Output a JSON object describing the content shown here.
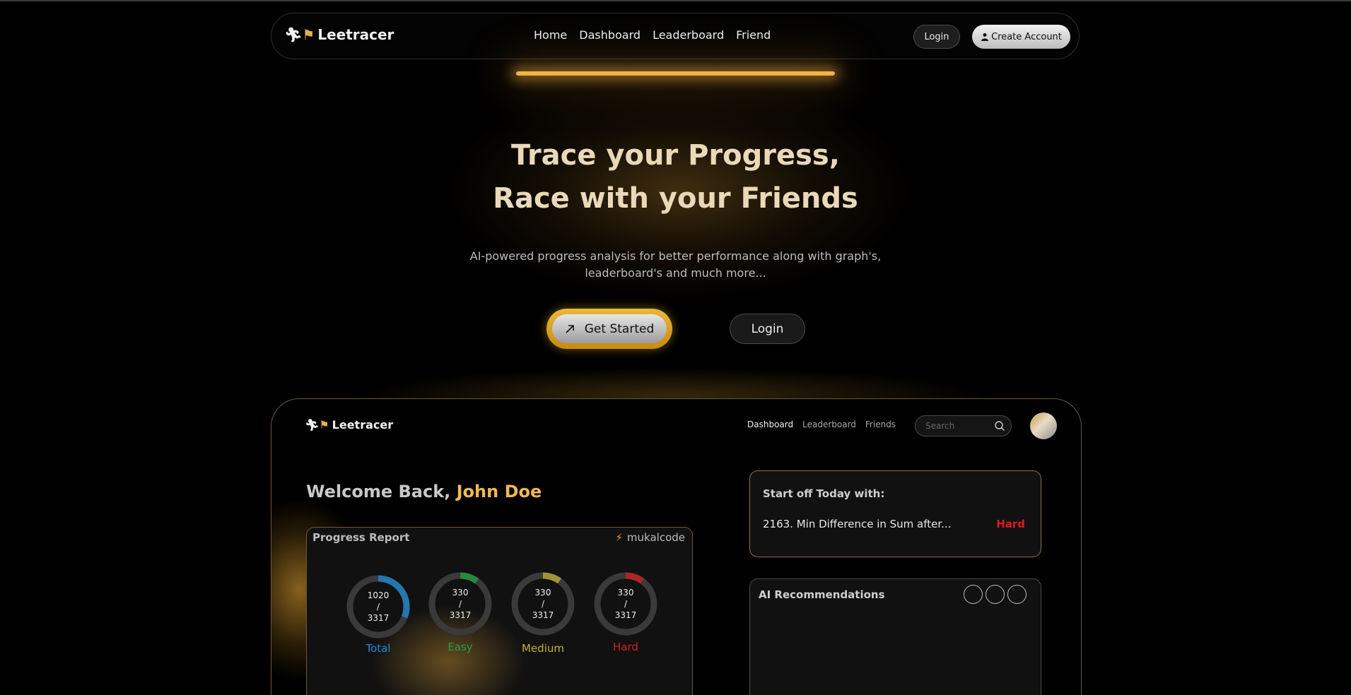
{
  "brand": {
    "name": "Leetracer"
  },
  "nav": {
    "links": [
      "Home",
      "Dashboard",
      "Leaderboard",
      "Friend"
    ],
    "login_label": "Login",
    "create_label": "Create Account"
  },
  "hero": {
    "title_line1": "Trace your Progress,",
    "title_line2": "Race with your Friends",
    "subtitle_line1": "AI-powered progress analysis for better performance along with graph's,",
    "subtitle_line2": "leaderboard's and much more...",
    "get_started_label": "Get Started",
    "login_label": "Login"
  },
  "dashboard": {
    "brand": "Leetracer",
    "nav": [
      "Dashboard",
      "Leaderboard",
      "Friends"
    ],
    "search_placeholder": "Search",
    "welcome_prefix": "Welcome Back, ",
    "user_name": "John Doe",
    "progress": {
      "title": "Progress Report",
      "username": "mukalcode",
      "rings": [
        {
          "label": "Total",
          "solved": "1020",
          "sep": "/",
          "total": "3317",
          "fraction": 0.31,
          "color": "#1c8ed8"
        },
        {
          "label": "Easy",
          "solved": "330",
          "sep": "/",
          "total": "3317",
          "fraction": 0.1,
          "color": "#26a146"
        },
        {
          "label": "Medium",
          "solved": "330",
          "sep": "/",
          "total": "3317",
          "fraction": 0.1,
          "color": "#c4b23a"
        },
        {
          "label": "Hard",
          "solved": "330",
          "sep": "/",
          "total": "3317",
          "fraction": 0.1,
          "color": "#d61f1f"
        }
      ]
    },
    "today": {
      "title": "Start off Today with:",
      "problem": "2163. Min Difference in Sum after...",
      "difficulty": "Hard"
    },
    "ai": {
      "title": "AI Recommendations"
    }
  }
}
